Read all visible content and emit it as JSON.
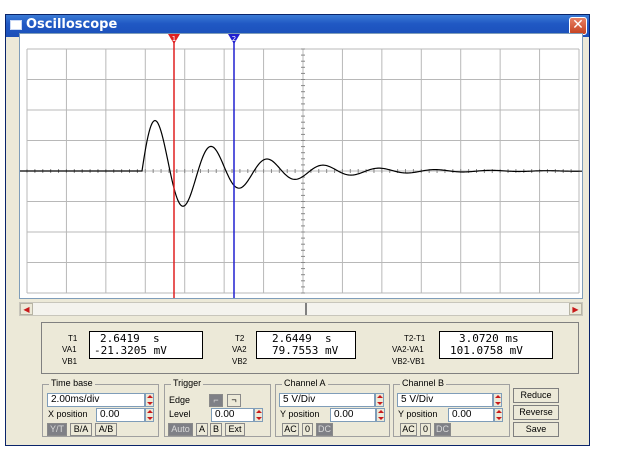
{
  "window": {
    "title": "Oscilloscope",
    "close_symbol": "✕"
  },
  "cursors": {
    "t1_marker": "1",
    "t2_marker": "2"
  },
  "readout": {
    "t1_label": "T1",
    "t1_value": "2.6419  s",
    "va1_label": "VA1",
    "va1_value": "-21.3205 mV",
    "vb1_label": "VB1",
    "vb1_value": "",
    "t2_label": "T2",
    "t2_value": "2.6449  s",
    "va2_label": "VA2",
    "va2_value": "79.7553 mV",
    "vb2_label": "VB2",
    "vb2_value": "",
    "dt_label": "T2-T1",
    "dt_value": "3.0720 ms",
    "dva_label": "VA2-VA1",
    "dva_value": "101.0758 mV",
    "dvb_label": "VB2-VB1",
    "dvb_value": ""
  },
  "timebase": {
    "label": "Time base",
    "scale": "2.00ms/div",
    "xpos_label": "X position",
    "xpos": "0.00",
    "buttons": [
      "Y/T",
      "B/A",
      "A/B"
    ]
  },
  "trigger": {
    "label": "Trigger",
    "edge_label": "Edge",
    "level_label": "Level",
    "level": "0.00",
    "buttons": [
      "Auto",
      "A",
      "B",
      "Ext"
    ]
  },
  "channel_a": {
    "label": "Channel A",
    "scale": "5  V/Div",
    "ypos_label": "Y position",
    "ypos": "0.00",
    "buttons": [
      "AC",
      "0",
      "DC"
    ]
  },
  "channel_b": {
    "label": "Channel B",
    "scale": "5  V/Div",
    "ypos_label": "Y position",
    "ypos": "0.00",
    "buttons": [
      "AC",
      "0",
      "DC"
    ]
  },
  "actions": [
    "Reduce",
    "Reverse",
    "Save"
  ],
  "colors": {
    "cursor1": "#e02020",
    "cursor2": "#2020d0",
    "grid": "#b8b8b8",
    "trace": "#000000"
  }
}
